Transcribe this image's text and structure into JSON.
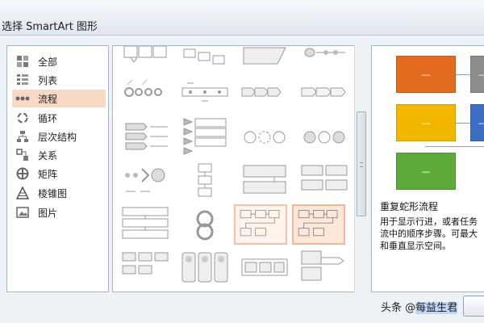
{
  "dialog": {
    "title": "选择 SmartArt 图形"
  },
  "categories": [
    {
      "label": "全部",
      "icon": "all-icon",
      "selected": false
    },
    {
      "label": "列表",
      "icon": "list-icon",
      "selected": false
    },
    {
      "label": "流程",
      "icon": "process-icon",
      "selected": true
    },
    {
      "label": "循环",
      "icon": "cycle-icon",
      "selected": false
    },
    {
      "label": "层次结构",
      "icon": "hierarchy-icon",
      "selected": false
    },
    {
      "label": "关系",
      "icon": "relationship-icon",
      "selected": false
    },
    {
      "label": "矩阵",
      "icon": "matrix-icon",
      "selected": false
    },
    {
      "label": "棱锥图",
      "icon": "pyramid-icon",
      "selected": false
    },
    {
      "label": "图片",
      "icon": "picture-icon",
      "selected": false
    }
  ],
  "gallery": {
    "selected_index": 17,
    "hover_index": 16
  },
  "preview": {
    "name": "重复蛇形流程",
    "description_lines": [
      "用于显示行进，或者任务",
      "流中的顺序步骤。可最大",
      "和垂直显示空间。"
    ],
    "box_text": "—",
    "colors": {
      "orange": "#e46c1f",
      "gray": "#8c8c8c",
      "yellow": "#f2b800",
      "blue": "#3c6fc4",
      "green": "#5faa3c"
    }
  },
  "watermark": {
    "prefix": "头条 @",
    "highlight": "每益生君"
  }
}
